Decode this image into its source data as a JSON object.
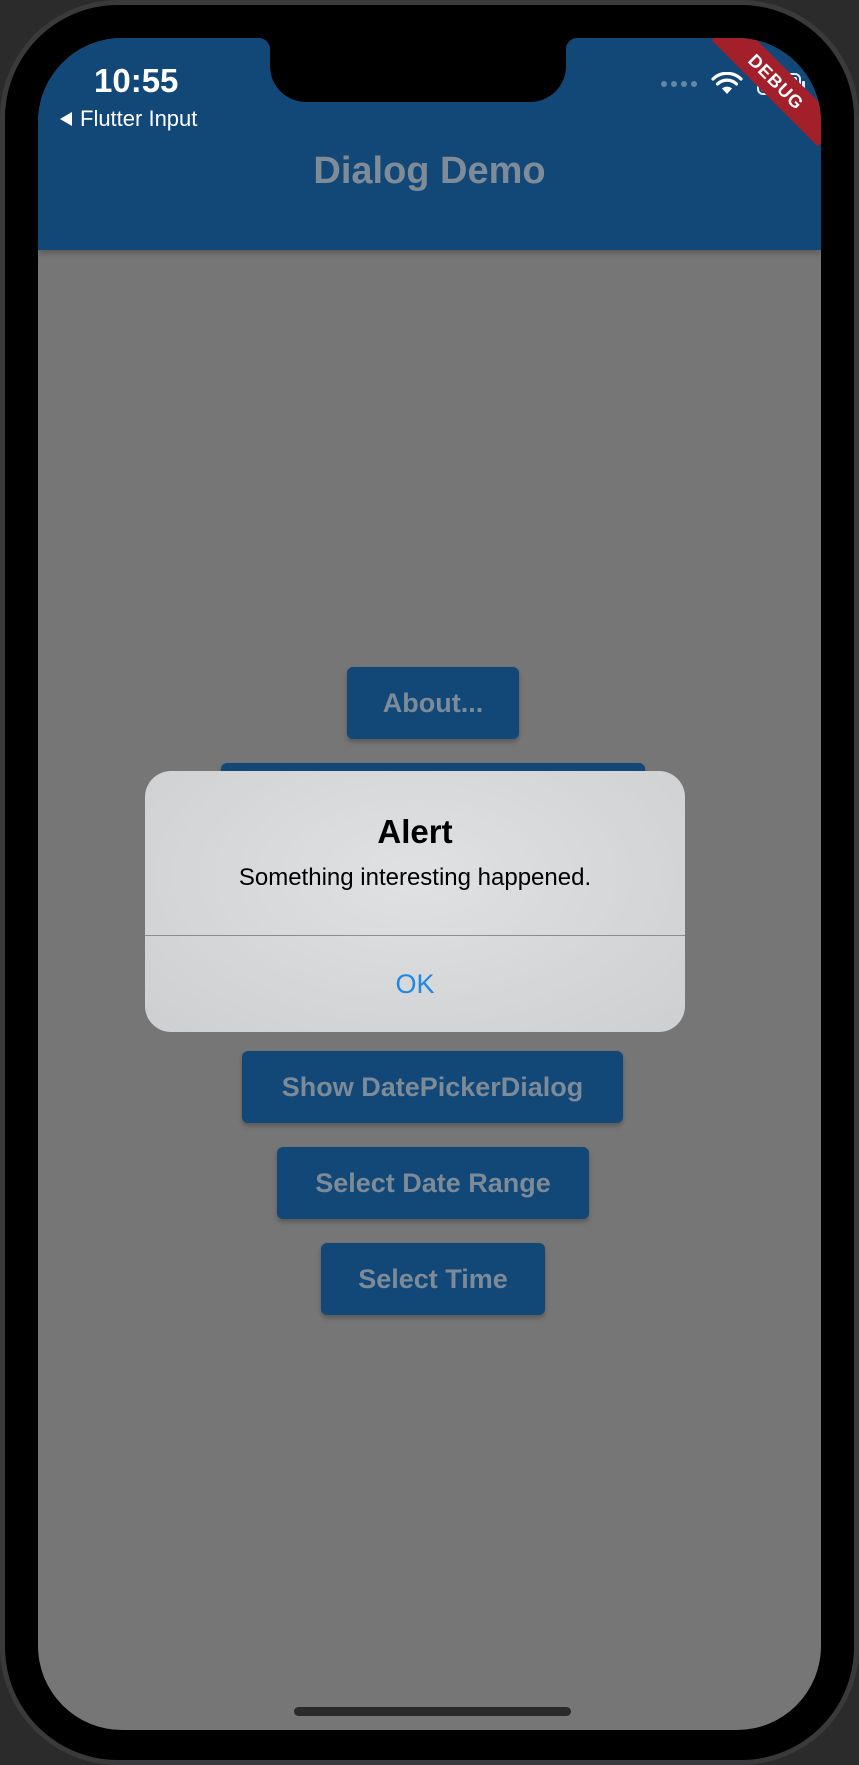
{
  "status_bar": {
    "time": "10:55",
    "back_label": "Flutter Input",
    "battery_level": 1.0
  },
  "debug_banner": "DEBUG",
  "app_bar": {
    "title": "Dialog Demo"
  },
  "buttons": {
    "about": "About...",
    "show_datepicker": "Show DatePickerDialog",
    "select_date_range": "Select Date Range",
    "select_time": "Select Time"
  },
  "dialog": {
    "title": "Alert",
    "message": "Something interesting happened.",
    "ok_label": "OK"
  },
  "colors": {
    "app_bar": "#114877",
    "scrim_background": "#767676",
    "button": "#114877",
    "dialog_action": "#1e88e5",
    "debug_banner": "#a3202b"
  }
}
